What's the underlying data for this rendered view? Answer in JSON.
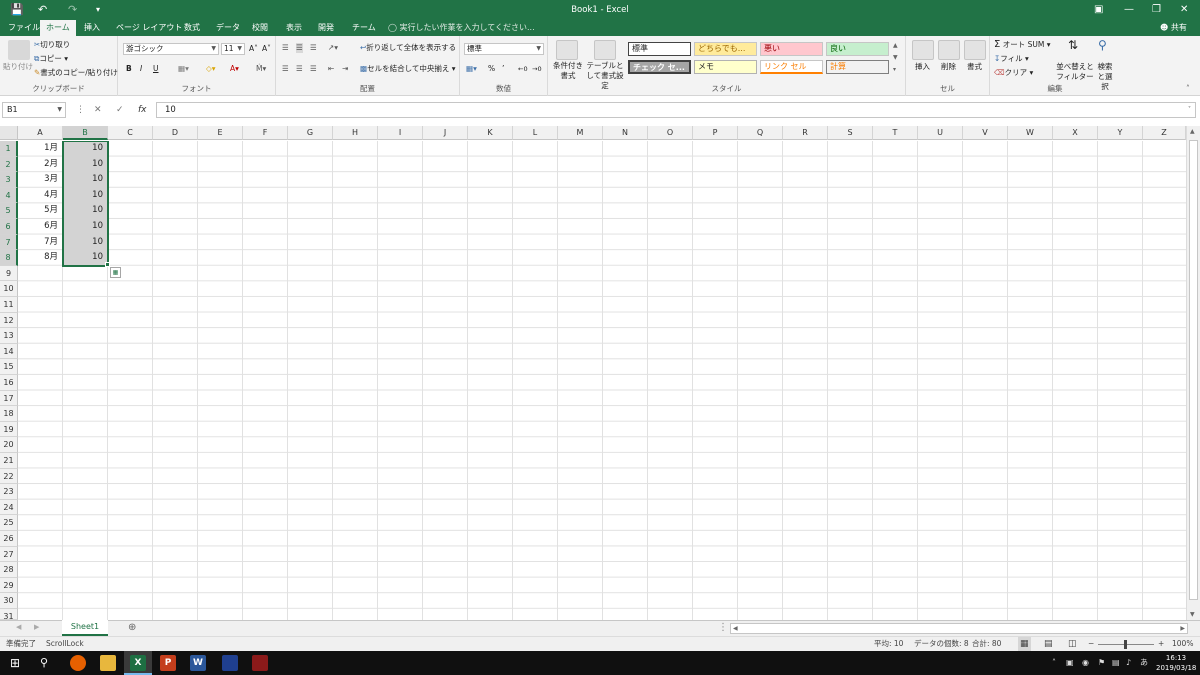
{
  "titlebar": {
    "title": "Book1 - Excel",
    "save_icon": "save-icon",
    "undo_icon": "undo-icon",
    "redo_icon": "redo-icon",
    "accent": "#217346"
  },
  "tabs": [
    "ファイル",
    "ホーム",
    "挿入",
    "ページ レイアウト",
    "数式",
    "データ",
    "校閲",
    "表示",
    "開発",
    "チーム"
  ],
  "active_tab": "ホーム",
  "tell_me": "実行したい作業を入力してください...",
  "share": "共有",
  "ribbon": {
    "clipboard": {
      "paste": "貼り付け",
      "cut": "切り取り",
      "copy": "コピー",
      "format_painter": "書式のコピー/貼り付け",
      "label": "クリップボード"
    },
    "font": {
      "name": "游ゴシック",
      "size": "11",
      "label": "フォント",
      "bold": "B",
      "italic": "I",
      "underline": "U"
    },
    "alignment": {
      "wrap": "折り返して全体を表示する",
      "merge": "セルを結合して中央揃え",
      "label": "配置"
    },
    "number": {
      "format": "標準",
      "label": "数値",
      "percent": "%"
    },
    "styles": {
      "conditional": "条件付き書式",
      "table": "テーブルとして書式設定",
      "cells": [
        "標準",
        "どちらでも...",
        "悪い",
        "良い",
        "チェック セ...",
        "メモ",
        "リンク セル",
        "計算"
      ],
      "label": "スタイル"
    },
    "cells_group": {
      "insert": "挿入",
      "delete": "削除",
      "format": "書式",
      "label": "セル"
    },
    "editing": {
      "autosum": "オート SUM",
      "fill": "フィル",
      "clear": "クリア",
      "sort": "並べ替えとフィルター",
      "find": "検索と選択",
      "label": "編集"
    }
  },
  "formula_bar": {
    "name_box": "B1",
    "fx": "fx",
    "value": "10"
  },
  "columns": [
    "A",
    "B",
    "C",
    "D",
    "E",
    "F",
    "G",
    "H",
    "I",
    "J",
    "K",
    "L",
    "M",
    "N",
    "O",
    "P",
    "Q",
    "R",
    "S",
    "T",
    "U",
    "V",
    "W",
    "X",
    "Y",
    "Z"
  ],
  "rows": [
    "1",
    "2",
    "3",
    "4",
    "5",
    "6",
    "7",
    "8",
    "9",
    "10",
    "11",
    "12",
    "13",
    "14",
    "15",
    "16",
    "17",
    "18",
    "19",
    "20",
    "21",
    "22",
    "23",
    "24",
    "25",
    "26",
    "27",
    "28",
    "29",
    "30",
    "31"
  ],
  "cells": {
    "A": [
      "1月",
      "2月",
      "3月",
      "4月",
      "5月",
      "6月",
      "7月",
      "8月"
    ],
    "B": [
      "10",
      "10",
      "10",
      "10",
      "10",
      "10",
      "10",
      "10"
    ]
  },
  "selected_column": "B",
  "selected_rows": [
    "1",
    "2",
    "3",
    "4",
    "5",
    "6",
    "7",
    "8"
  ],
  "sheet_tab": "Sheet1",
  "status": {
    "ready": "準備完了",
    "scroll_lock": "ScrollLock",
    "average": "平均: 10",
    "count": "データの個数: 8",
    "sum": "合計: 80",
    "zoom": "100%"
  },
  "taskbar": {
    "time": "16:13",
    "date": "2019/03/18",
    "ime": "あ"
  }
}
